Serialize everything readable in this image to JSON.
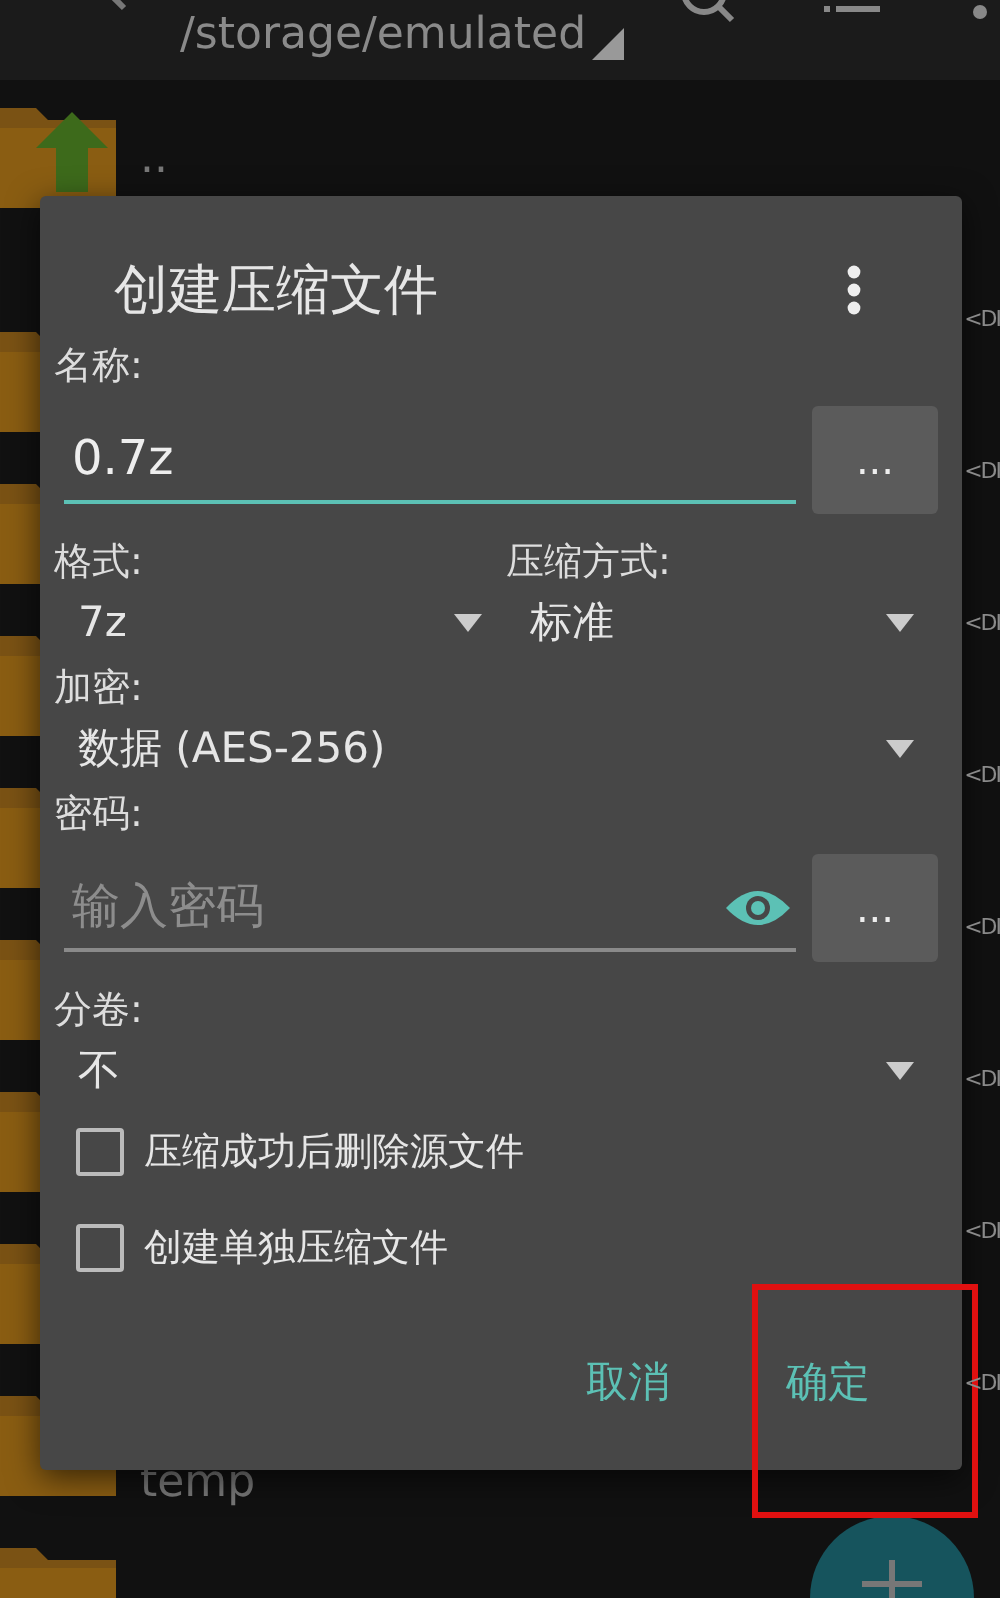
{
  "toolbar": {
    "path": "/storage/emulated"
  },
  "files": [
    {
      "kind": "parent",
      "name": ".."
    },
    {
      "kind": "folder",
      "type": "<DI"
    },
    {
      "kind": "folder",
      "type": "<DI"
    },
    {
      "kind": "folder",
      "type": "<DI"
    },
    {
      "kind": "folder",
      "type": "<DI"
    },
    {
      "kind": "folder",
      "type": "<DI"
    },
    {
      "kind": "folder",
      "type": "<DI"
    },
    {
      "kind": "folder",
      "type": "<DI"
    },
    {
      "kind": "folder",
      "name": "temp",
      "type": "<DI"
    },
    {
      "kind": "folder"
    }
  ],
  "dialog": {
    "title": "创建压缩文件",
    "name_label": "名称:",
    "name_field": {
      "value": "0.7z",
      "focused": true
    },
    "name_button": "...",
    "format_label": "格式:",
    "format_value": "7z",
    "method_label": "压缩方式:",
    "method_value": "标准",
    "encryption_label": "加密:",
    "encryption_value": "数据 (AES-256)",
    "password_label": "密码:",
    "password_field": {
      "placeholder": "输入密码",
      "focused": false
    },
    "password_button": "...",
    "split_label": "分卷:",
    "split_value": "不",
    "options": [
      {
        "label": "压缩成功后删除源文件",
        "checked": false
      },
      {
        "label": "创建单独压缩文件",
        "checked": false
      }
    ],
    "buttons": [
      {
        "label": "取消",
        "highlighted": false
      },
      {
        "label": "确定",
        "highlighted": true
      }
    ]
  }
}
